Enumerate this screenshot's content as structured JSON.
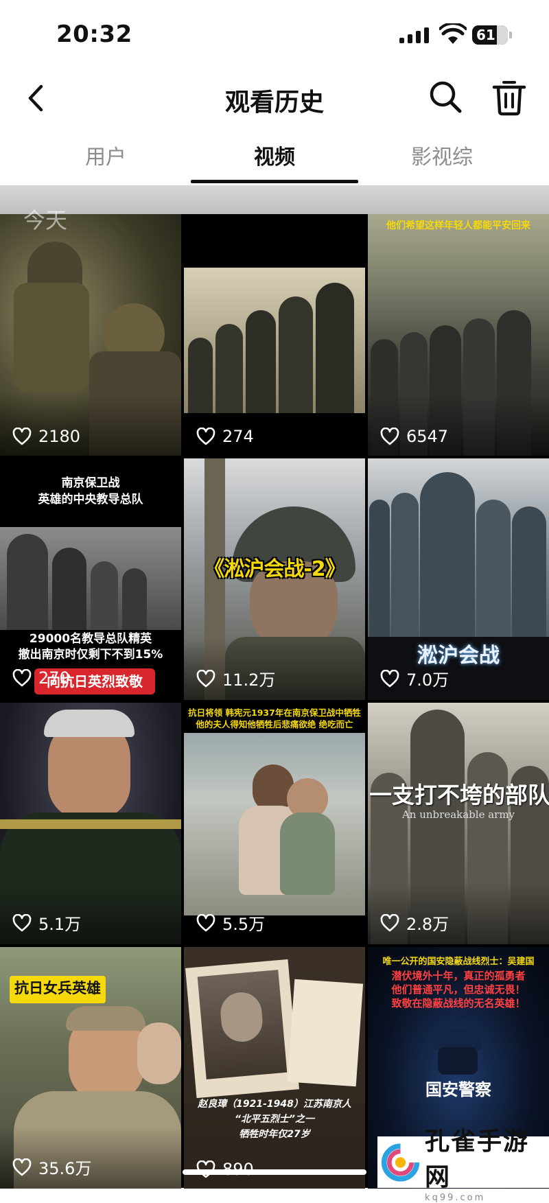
{
  "status_bar": {
    "time": "20:32",
    "battery": "61"
  },
  "header": {
    "title": "观看历史"
  },
  "tabs": [
    {
      "label": "用户",
      "active": false
    },
    {
      "label": "视频",
      "active": true
    },
    {
      "label": "影视综",
      "active": false
    }
  ],
  "section": {
    "label": "今天"
  },
  "videos": [
    {
      "likes": "2180",
      "overlay": ""
    },
    {
      "likes": "274",
      "overlay": ""
    },
    {
      "likes": "6547",
      "overlay": "他们希望这样年轻人都能平安回来"
    },
    {
      "likes": "270",
      "overlay": "南京保卫战\n英雄的中央教导总队",
      "overlay2": "29000名教导总队精英\n撤出南京时仅剩下不到15%",
      "badge": "向抗日英烈致敬"
    },
    {
      "likes": "11.2万",
      "overlay": "《淞沪会战-2》"
    },
    {
      "likes": "7.0万",
      "overlay": "淞沪会战"
    },
    {
      "likes": "5.1万",
      "overlay": ""
    },
    {
      "likes": "5.5万",
      "overlay": "抗日将领 韩宪元1937年在南京保卫战中牺牲\n他的夫人得知他牺牲后悲痛欲绝 绝吃而亡"
    },
    {
      "likes": "2.8万",
      "overlay": "一支打不垮的部队",
      "overlay2": "An unbreakable army"
    },
    {
      "likes": "35.6万",
      "overlay": "抗日女兵英雄"
    },
    {
      "likes": "890",
      "overlay": "赵良璋（1921-1948）江苏南京人\n“北平五烈士”之一\n牺牲时年仅27岁"
    },
    {
      "likes": "",
      "overlay": "唯一公开的国安隐蔽战线烈士：吴建国",
      "overlay2": "潜伏境外十年，真正的孤勇者\n他们普通平凡，但忠诚无畏！\n致敬在隐蔽战线的无名英雄！",
      "overlay3": "国安警察"
    }
  ],
  "watermark": {
    "name": "孔雀手游网",
    "domain": "kq99.com"
  },
  "colors": {
    "accent": "#111111",
    "inactive_tab": "#8c8c8c",
    "badge_red": "#d8262c",
    "caption_yellow": "#f5d90a"
  }
}
